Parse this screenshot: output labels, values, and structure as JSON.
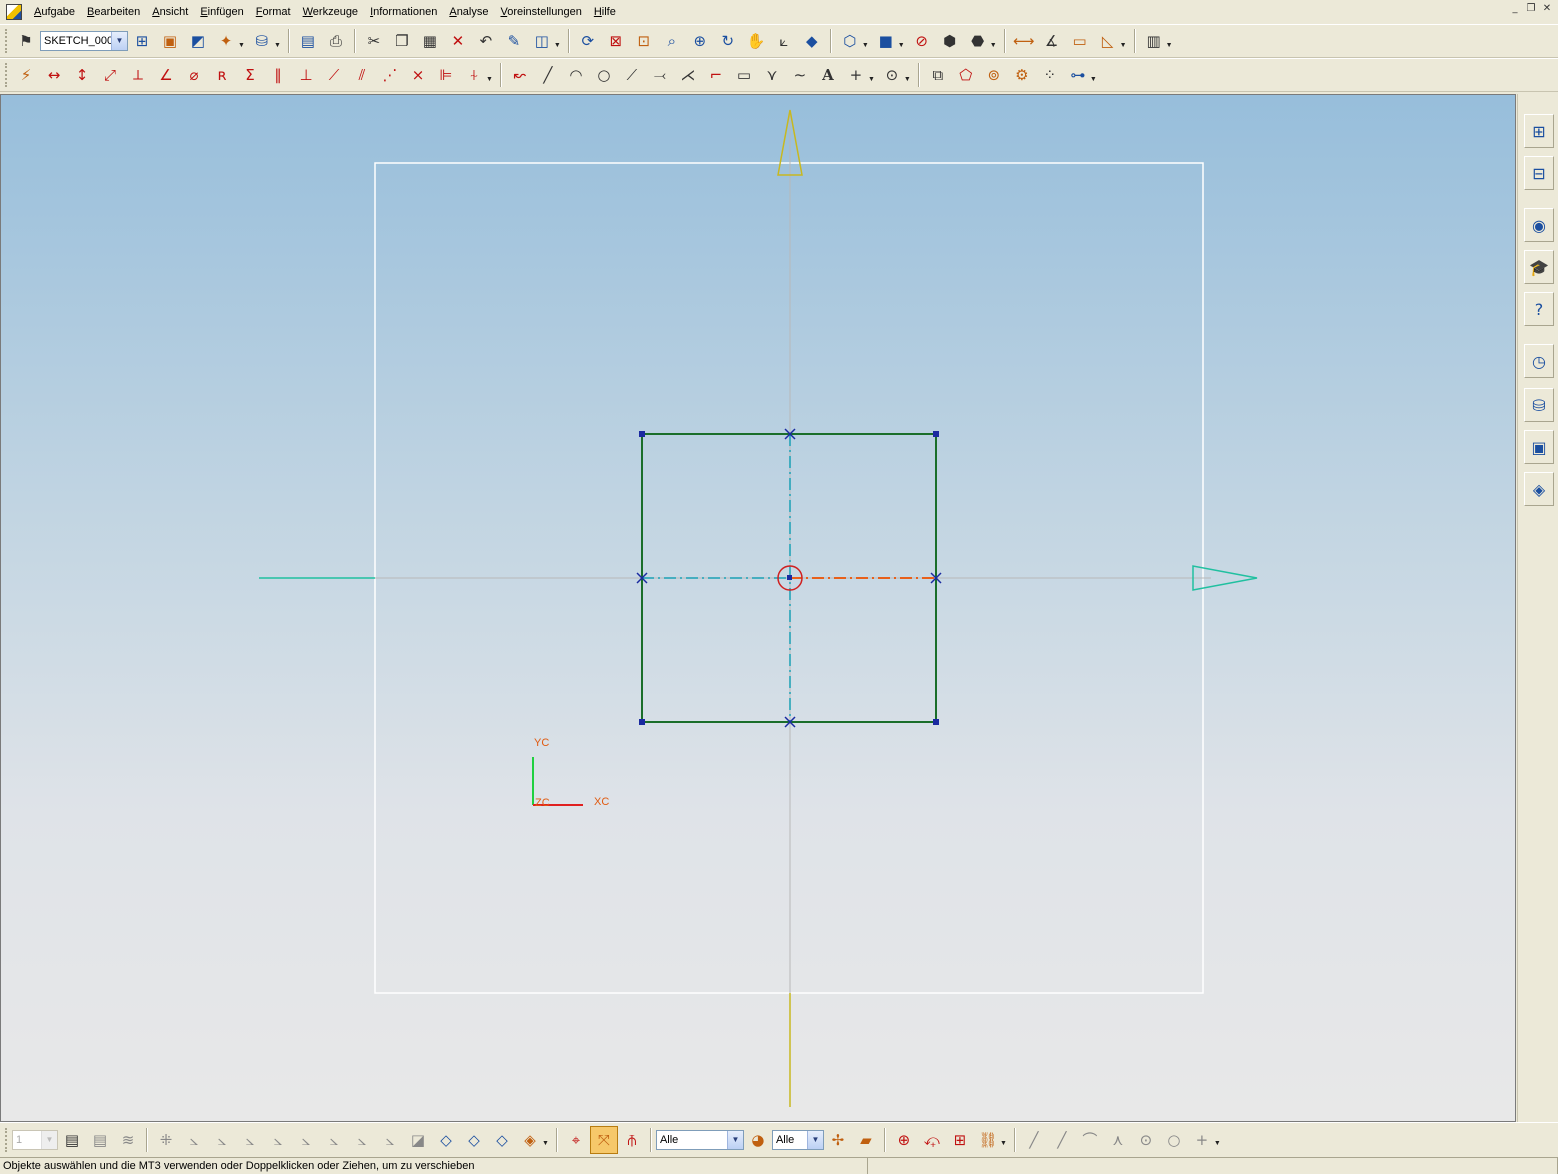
{
  "menubar": {
    "items": [
      {
        "id": "aufgabe",
        "label": "Aufgabe"
      },
      {
        "id": "bearbeiten",
        "label": "Bearbeiten"
      },
      {
        "id": "ansicht",
        "label": "Ansicht"
      },
      {
        "id": "einfuegen",
        "label": "Einfügen"
      },
      {
        "id": "format",
        "label": "Format"
      },
      {
        "id": "werkzeuge",
        "label": "Werkzeuge"
      },
      {
        "id": "informationen",
        "label": "Informationen"
      },
      {
        "id": "analyse",
        "label": "Analyse"
      },
      {
        "id": "voreinstellungen",
        "label": "Voreinstellungen"
      },
      {
        "id": "hilfe",
        "label": "Hilfe"
      }
    ],
    "window_controls": {
      "minimize": "_",
      "restore": "❐",
      "close": "✕"
    }
  },
  "toolbar_top": {
    "sketch_name_value": "SKETCH_000"
  },
  "viewport": {
    "csys_labels": {
      "yc": "YC",
      "zc": "ZC",
      "xc": "XC"
    }
  },
  "selection_bar": {
    "layer_value": "1",
    "type_filter_value": "Alle",
    "scope_filter_value": "Alle"
  },
  "status": {
    "prompt": "Objekte auswählen und die MT3 verwenden oder Doppelklicken oder Ziehen, um zu verschieben"
  },
  "colors": {
    "sketch_profile": "#1a6e2a",
    "reference_line": "#1aa0b4",
    "highlight_line": "#e8601a",
    "x_axis_arrow": "#20c0a0",
    "y_axis_arrow": "#c8b820",
    "vertex_marker": "#1a2aa0",
    "active_tool": "#f6c86a"
  }
}
